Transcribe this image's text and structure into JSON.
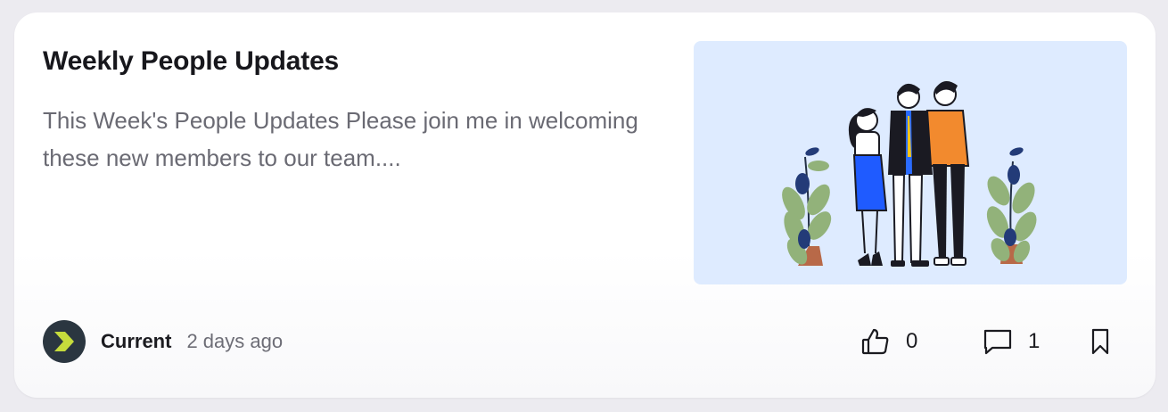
{
  "post": {
    "title": "Weekly People Updates",
    "excerpt": "This Week's People Updates Please join me in welcoming these new members to our team....",
    "image_icon": "illustration-three-people-with-plants"
  },
  "author": {
    "name": "Current",
    "time": "2 days ago",
    "avatar_icon": "current-logo-icon"
  },
  "actions": {
    "likes": "0",
    "comments": "1",
    "like_icon": "thumbs-up-icon",
    "comment_icon": "comment-icon",
    "bookmark_icon": "bookmark-icon"
  },
  "colors": {
    "background": "#ecebf0",
    "card": "#ffffff",
    "image_bg": "#deebff",
    "title": "#17171c",
    "muted_text": "#6a6a73",
    "avatar_bg": "#2b3640",
    "avatar_mark": "#c6dc3c"
  }
}
